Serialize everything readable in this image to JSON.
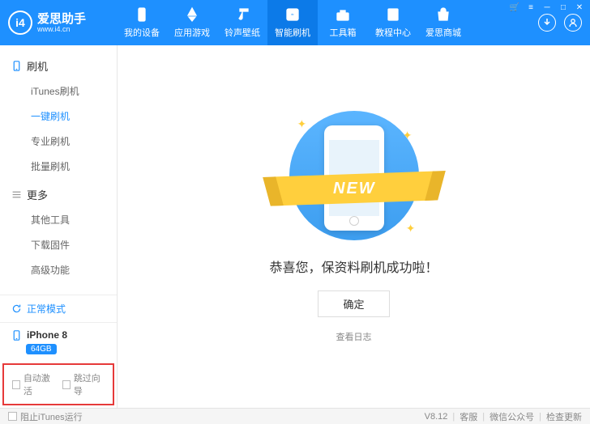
{
  "logo": {
    "badge": "i4",
    "title": "爱思助手",
    "url": "www.i4.cn"
  },
  "nav": [
    {
      "label": "我的设备",
      "icon": "device"
    },
    {
      "label": "应用游戏",
      "icon": "apps"
    },
    {
      "label": "铃声壁纸",
      "icon": "music"
    },
    {
      "label": "智能刷机",
      "icon": "flash",
      "active": true
    },
    {
      "label": "工具箱",
      "icon": "toolbox"
    },
    {
      "label": "教程中心",
      "icon": "book"
    },
    {
      "label": "爱思商城",
      "icon": "shop"
    }
  ],
  "sidebar": {
    "groups": [
      {
        "title": "刷机",
        "items": [
          {
            "label": "iTunes刷机"
          },
          {
            "label": "一键刷机",
            "active": true
          },
          {
            "label": "专业刷机"
          },
          {
            "label": "批量刷机"
          }
        ]
      },
      {
        "title": "更多",
        "items": [
          {
            "label": "其他工具"
          },
          {
            "label": "下载固件"
          },
          {
            "label": "高级功能"
          }
        ]
      }
    ],
    "status": "正常模式",
    "device": {
      "name": "iPhone 8",
      "capacity": "64GB"
    },
    "options": [
      {
        "label": "自动激活"
      },
      {
        "label": "跳过向导"
      }
    ]
  },
  "main": {
    "ribbon": "NEW",
    "message": "恭喜您，保资料刷机成功啦！",
    "confirm": "确定",
    "log_link": "查看日志"
  },
  "footer": {
    "block_itunes": "阻止iTunes运行",
    "version": "V8.12",
    "support": "客服",
    "wechat": "微信公众号",
    "update": "检查更新"
  }
}
